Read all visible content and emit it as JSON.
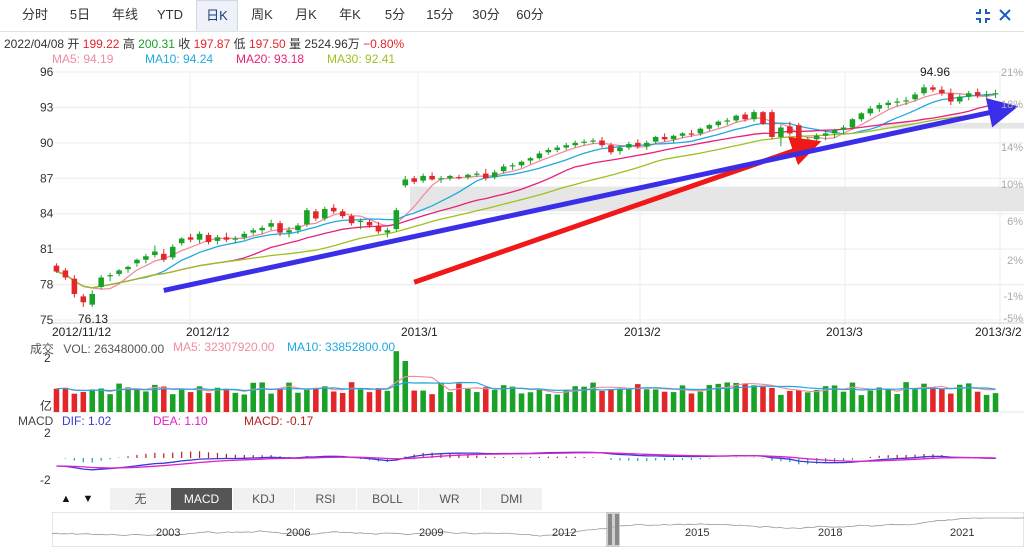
{
  "tabs": [
    {
      "label": "分时"
    },
    {
      "label": "5日"
    },
    {
      "label": "年线"
    },
    {
      "label": "YTD"
    },
    {
      "label": "日K",
      "active": true
    },
    {
      "label": "周K"
    },
    {
      "label": "月K"
    },
    {
      "label": "年K"
    },
    {
      "label": "5分"
    },
    {
      "label": "15分"
    },
    {
      "label": "30分"
    },
    {
      "label": "60分"
    }
  ],
  "info": {
    "date": "2022/04/08",
    "open_label": "开",
    "open": "199.22",
    "high_label": "高",
    "high": "200.31",
    "close_label": "收",
    "close": "197.87",
    "low_label": "低",
    "low": "197.50",
    "vol_label": "量",
    "vol": "2524.96万",
    "change": "−0.80%"
  },
  "ma": {
    "ma5": "MA5: 94.19",
    "ma10": "MA10: 94.24",
    "ma20": "MA20: 93.18",
    "ma30": "MA30: 92.41",
    "colors": {
      "ma5": "#f08ca0",
      "ma10": "#20a8e0",
      "ma20": "#e8207a",
      "ma30": "#9cc221"
    }
  },
  "vol_legend": {
    "title": "成交",
    "vol": "VOL: 26348000.00",
    "ma5": "MA5: 32307920.00",
    "ma10": "MA10: 33852800.00"
  },
  "macd_legend": {
    "title": "MACD",
    "dif": "DIF: 1.02",
    "dea": "DEA: 1.10",
    "macd": "MACD: -0.17"
  },
  "indicators": [
    {
      "label": "无"
    },
    {
      "label": "MACD",
      "active": true
    },
    {
      "label": "KDJ"
    },
    {
      "label": "RSI"
    },
    {
      "label": "BOLL"
    },
    {
      "label": "WR"
    },
    {
      "label": "DMI"
    }
  ],
  "navigator_years": [
    "2003",
    "2006",
    "2009",
    "2012",
    "2015",
    "2018",
    "2021"
  ],
  "chart_data": {
    "type": "candlestick",
    "price_axis": {
      "ticks": [
        96,
        93,
        90,
        87,
        84,
        81,
        78,
        75
      ],
      "range": [
        75,
        96
      ]
    },
    "pct_axis": {
      "ticks": [
        "21%",
        "18%",
        "14%",
        "10%",
        "6%",
        "2%",
        "-1%",
        "-5%"
      ]
    },
    "date_labels": [
      "2012/11/12",
      "2012/12",
      "2013/1",
      "2013/2",
      "2013/3",
      "2013/3/2"
    ],
    "annotations": {
      "max": "94.96",
      "min": "76.13"
    },
    "vol_axis": {
      "ticks": [
        "2",
        "亿"
      ]
    },
    "macd_axis": {
      "ticks": [
        "2",
        "-2"
      ]
    },
    "candles": [
      {
        "o": 79.6,
        "h": 79.8,
        "l": 79.0,
        "c": 79.1
      },
      {
        "o": 79.2,
        "h": 79.4,
        "l": 78.4,
        "c": 78.6
      },
      {
        "o": 78.5,
        "h": 78.8,
        "l": 76.9,
        "c": 77.2
      },
      {
        "o": 77.0,
        "h": 77.2,
        "l": 76.1,
        "c": 76.5
      },
      {
        "o": 76.3,
        "h": 77.5,
        "l": 76.1,
        "c": 77.2
      },
      {
        "o": 77.8,
        "h": 78.8,
        "l": 77.6,
        "c": 78.6
      },
      {
        "o": 78.7,
        "h": 79.0,
        "l": 78.3,
        "c": 78.8
      },
      {
        "o": 78.9,
        "h": 79.3,
        "l": 78.7,
        "c": 79.2
      },
      {
        "o": 79.3,
        "h": 79.6,
        "l": 79.0,
        "c": 79.5
      },
      {
        "o": 79.8,
        "h": 80.2,
        "l": 79.5,
        "c": 80.1
      },
      {
        "o": 80.1,
        "h": 80.6,
        "l": 79.8,
        "c": 80.4
      },
      {
        "o": 80.5,
        "h": 81.3,
        "l": 80.3,
        "c": 80.8
      },
      {
        "o": 80.6,
        "h": 81.0,
        "l": 79.9,
        "c": 80.1
      },
      {
        "o": 80.3,
        "h": 81.4,
        "l": 80.1,
        "c": 81.2
      },
      {
        "o": 81.5,
        "h": 82.0,
        "l": 81.3,
        "c": 81.9
      },
      {
        "o": 82.0,
        "h": 82.3,
        "l": 81.6,
        "c": 81.8
      },
      {
        "o": 81.8,
        "h": 82.5,
        "l": 81.5,
        "c": 82.3
      },
      {
        "o": 82.2,
        "h": 82.4,
        "l": 81.4,
        "c": 81.6
      },
      {
        "o": 81.7,
        "h": 82.2,
        "l": 81.4,
        "c": 82.0
      },
      {
        "o": 82.0,
        "h": 82.4,
        "l": 81.6,
        "c": 81.8
      },
      {
        "o": 81.8,
        "h": 82.1,
        "l": 81.5,
        "c": 81.9
      },
      {
        "o": 82.0,
        "h": 82.5,
        "l": 81.8,
        "c": 82.3
      },
      {
        "o": 82.4,
        "h": 82.8,
        "l": 82.2,
        "c": 82.6
      },
      {
        "o": 82.6,
        "h": 83.0,
        "l": 82.3,
        "c": 82.8
      },
      {
        "o": 82.9,
        "h": 83.5,
        "l": 82.6,
        "c": 83.2
      },
      {
        "o": 83.2,
        "h": 83.4,
        "l": 82.1,
        "c": 82.4
      },
      {
        "o": 82.4,
        "h": 82.9,
        "l": 82.0,
        "c": 82.6
      },
      {
        "o": 82.6,
        "h": 83.2,
        "l": 82.3,
        "c": 83.0
      },
      {
        "o": 83.1,
        "h": 84.5,
        "l": 82.9,
        "c": 84.3
      },
      {
        "o": 84.2,
        "h": 84.4,
        "l": 83.4,
        "c": 83.6
      },
      {
        "o": 83.6,
        "h": 84.6,
        "l": 83.4,
        "c": 84.4
      },
      {
        "o": 84.5,
        "h": 84.8,
        "l": 84.0,
        "c": 84.2
      },
      {
        "o": 84.2,
        "h": 84.4,
        "l": 83.6,
        "c": 83.8
      },
      {
        "o": 83.8,
        "h": 84.0,
        "l": 83.0,
        "c": 83.2
      },
      {
        "o": 83.3,
        "h": 83.6,
        "l": 82.7,
        "c": 83.4
      },
      {
        "o": 83.3,
        "h": 83.5,
        "l": 82.8,
        "c": 83.0
      },
      {
        "o": 83.0,
        "h": 83.3,
        "l": 82.3,
        "c": 82.5
      },
      {
        "o": 82.4,
        "h": 82.8,
        "l": 82.0,
        "c": 82.6
      },
      {
        "o": 82.7,
        "h": 84.5,
        "l": 82.5,
        "c": 84.3
      },
      {
        "o": 86.4,
        "h": 87.2,
        "l": 86.2,
        "c": 86.9
      },
      {
        "o": 87.0,
        "h": 87.2,
        "l": 86.5,
        "c": 86.7
      },
      {
        "o": 86.8,
        "h": 87.4,
        "l": 86.6,
        "c": 87.2
      },
      {
        "o": 87.2,
        "h": 87.5,
        "l": 86.8,
        "c": 86.9
      },
      {
        "o": 86.9,
        "h": 87.2,
        "l": 86.6,
        "c": 87.0
      },
      {
        "o": 87.0,
        "h": 87.3,
        "l": 86.8,
        "c": 87.2
      },
      {
        "o": 87.1,
        "h": 87.3,
        "l": 86.9,
        "c": 87.0
      },
      {
        "o": 87.1,
        "h": 87.4,
        "l": 86.9,
        "c": 87.3
      },
      {
        "o": 87.3,
        "h": 87.6,
        "l": 87.1,
        "c": 87.4
      },
      {
        "o": 87.4,
        "h": 87.8,
        "l": 86.8,
        "c": 87.0
      },
      {
        "o": 87.1,
        "h": 87.7,
        "l": 86.9,
        "c": 87.5
      },
      {
        "o": 87.6,
        "h": 88.2,
        "l": 87.4,
        "c": 88.0
      },
      {
        "o": 88.0,
        "h": 88.3,
        "l": 87.7,
        "c": 88.1
      },
      {
        "o": 88.1,
        "h": 88.5,
        "l": 87.9,
        "c": 88.4
      },
      {
        "o": 88.5,
        "h": 88.8,
        "l": 88.2,
        "c": 88.7
      },
      {
        "o": 88.7,
        "h": 89.3,
        "l": 88.6,
        "c": 89.1
      },
      {
        "o": 89.2,
        "h": 89.6,
        "l": 89.0,
        "c": 89.4
      },
      {
        "o": 89.4,
        "h": 89.8,
        "l": 89.2,
        "c": 89.6
      },
      {
        "o": 89.6,
        "h": 90.0,
        "l": 89.4,
        "c": 89.8
      },
      {
        "o": 89.8,
        "h": 90.2,
        "l": 89.6,
        "c": 90.0
      },
      {
        "o": 90.0,
        "h": 90.3,
        "l": 89.8,
        "c": 90.1
      },
      {
        "o": 90.1,
        "h": 90.4,
        "l": 89.9,
        "c": 90.2
      },
      {
        "o": 90.2,
        "h": 90.5,
        "l": 89.6,
        "c": 89.8
      },
      {
        "o": 89.8,
        "h": 90.0,
        "l": 89.0,
        "c": 89.2
      },
      {
        "o": 89.3,
        "h": 89.8,
        "l": 89.0,
        "c": 89.6
      },
      {
        "o": 89.6,
        "h": 90.1,
        "l": 89.4,
        "c": 89.9
      },
      {
        "o": 90.0,
        "h": 90.3,
        "l": 89.5,
        "c": 89.7
      },
      {
        "o": 89.7,
        "h": 90.2,
        "l": 89.4,
        "c": 90.0
      },
      {
        "o": 90.1,
        "h": 90.6,
        "l": 89.9,
        "c": 90.5
      },
      {
        "o": 90.5,
        "h": 90.8,
        "l": 90.1,
        "c": 90.3
      },
      {
        "o": 90.3,
        "h": 90.7,
        "l": 90.0,
        "c": 90.6
      },
      {
        "o": 90.6,
        "h": 90.9,
        "l": 90.4,
        "c": 90.8
      },
      {
        "o": 90.8,
        "h": 91.1,
        "l": 90.5,
        "c": 90.7
      },
      {
        "o": 90.8,
        "h": 91.3,
        "l": 90.6,
        "c": 91.2
      },
      {
        "o": 91.2,
        "h": 91.6,
        "l": 91.0,
        "c": 91.5
      },
      {
        "o": 91.5,
        "h": 91.9,
        "l": 91.3,
        "c": 91.8
      },
      {
        "o": 91.8,
        "h": 92.1,
        "l": 91.5,
        "c": 91.9
      },
      {
        "o": 91.9,
        "h": 92.4,
        "l": 91.7,
        "c": 92.3
      },
      {
        "o": 92.4,
        "h": 92.6,
        "l": 91.8,
        "c": 92.0
      },
      {
        "o": 92.0,
        "h": 92.8,
        "l": 91.8,
        "c": 92.6
      },
      {
        "o": 92.6,
        "h": 92.7,
        "l": 91.5,
        "c": 91.6
      },
      {
        "o": 92.6,
        "h": 92.8,
        "l": 90.3,
        "c": 90.5
      },
      {
        "o": 90.5,
        "h": 91.5,
        "l": 89.7,
        "c": 91.3
      },
      {
        "o": 91.4,
        "h": 91.8,
        "l": 90.6,
        "c": 90.8
      },
      {
        "o": 91.5,
        "h": 91.7,
        "l": 89.0,
        "c": 89.3
      },
      {
        "o": 89.3,
        "h": 90.5,
        "l": 89.0,
        "c": 90.3
      },
      {
        "o": 90.3,
        "h": 90.8,
        "l": 89.8,
        "c": 90.6
      },
      {
        "o": 90.6,
        "h": 91.0,
        "l": 90.2,
        "c": 90.8
      },
      {
        "o": 90.8,
        "h": 91.2,
        "l": 90.4,
        "c": 91.1
      },
      {
        "o": 91.1,
        "h": 91.5,
        "l": 90.7,
        "c": 91.3
      },
      {
        "o": 91.3,
        "h": 92.1,
        "l": 91.1,
        "c": 92.0
      },
      {
        "o": 92.0,
        "h": 92.6,
        "l": 91.8,
        "c": 92.5
      },
      {
        "o": 92.5,
        "h": 93.1,
        "l": 92.3,
        "c": 92.9
      },
      {
        "o": 92.9,
        "h": 93.4,
        "l": 92.6,
        "c": 93.2
      },
      {
        "o": 93.2,
        "h": 93.6,
        "l": 92.9,
        "c": 93.4
      },
      {
        "o": 93.4,
        "h": 93.8,
        "l": 93.1,
        "c": 93.5
      },
      {
        "o": 93.5,
        "h": 93.9,
        "l": 93.2,
        "c": 93.6
      },
      {
        "o": 93.7,
        "h": 94.3,
        "l": 93.5,
        "c": 94.1
      },
      {
        "o": 94.2,
        "h": 94.96,
        "l": 94.0,
        "c": 94.7
      },
      {
        "o": 94.7,
        "h": 94.9,
        "l": 94.3,
        "c": 94.5
      },
      {
        "o": 94.5,
        "h": 94.8,
        "l": 94.0,
        "c": 94.2
      },
      {
        "o": 94.2,
        "h": 94.6,
        "l": 93.2,
        "c": 93.5
      },
      {
        "o": 93.5,
        "h": 94.1,
        "l": 93.3,
        "c": 93.9
      },
      {
        "o": 93.9,
        "h": 94.4,
        "l": 93.6,
        "c": 94.2
      },
      {
        "o": 94.3,
        "h": 94.6,
        "l": 93.8,
        "c": 94.0
      },
      {
        "o": 94.0,
        "h": 94.4,
        "l": 93.7,
        "c": 94.1
      },
      {
        "o": 94.1,
        "h": 94.5,
        "l": 93.8,
        "c": 94.2
      }
    ],
    "arrows": [
      {
        "color": "#f01818",
        "from": [
          40,
          78.2
        ],
        "to": [
          85,
          90.0
        ]
      },
      {
        "color": "#3a2ee8",
        "from": [
          12,
          77.5
        ],
        "to": [
          107,
          93.0
        ]
      }
    ]
  }
}
